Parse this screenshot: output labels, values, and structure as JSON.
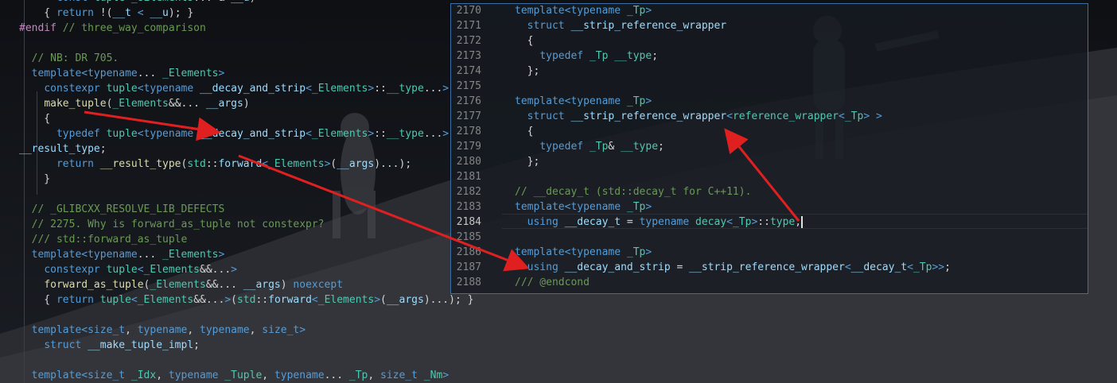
{
  "editor": {
    "main_lines": [
      "      const tuple<_UElements...>& __u)",
      "    { return !(__t < __u); }",
      "#endif // three_way_comparison",
      "",
      "  // NB: DR 705.",
      "  template<typename... _Elements>",
      "    constexpr tuple<typename __decay_and_strip<_Elements>::__type...>",
      "    make_tuple(_Elements&&... __args)",
      "    {",
      "      typedef tuple<typename __decay_and_strip<_Elements>::__type...>",
      "__result_type;",
      "      return __result_type(std::forward<_Elements>(__args)...);",
      "    }",
      "",
      "  // _GLIBCXX_RESOLVE_LIB_DEFECTS",
      "  // 2275. Why is forward_as_tuple not constexpr?",
      "  /// std::forward_as_tuple",
      "  template<typename... _Elements>",
      "    constexpr tuple<_Elements&&...>",
      "    forward_as_tuple(_Elements&&... __args) noexcept",
      "    { return tuple<_Elements&&...>(std::forward<_Elements>(__args)...); }",
      "",
      "  template<size_t, typename, typename, size_t>",
      "    struct __make_tuple_impl;",
      "",
      "  template<size_t _Idx, typename _Tuple, typename... _Tp, size_t _Nm>"
    ],
    "peek_line_numbers": [
      "2170",
      "2171",
      "2172",
      "2173",
      "2174",
      "2175",
      "2176",
      "2177",
      "2178",
      "2179",
      "2180",
      "2181",
      "2182",
      "2183",
      "2184",
      "2185",
      "2186",
      "2187",
      "2188"
    ],
    "peek_active_line": "2184",
    "peek_lines": [
      "template<typename _Tp>",
      "  struct __strip_reference_wrapper",
      "  {",
      "    typedef _Tp __type;",
      "  };",
      "",
      "template<typename _Tp>",
      "  struct __strip_reference_wrapper<reference_wrapper<_Tp> >",
      "  {",
      "    typedef _Tp& __type;",
      "  };",
      "",
      "// __decay_t (std::decay_t for C++11).",
      "template<typename _Tp>",
      "  using __decay_t = typename decay<_Tp>::type;",
      "",
      "template<typename _Tp>",
      "  using __decay_and_strip = __strip_reference_wrapper<__decay_t<_Tp>>;",
      "/// @endcond"
    ]
  },
  "colors": {
    "keyword": "#569cd6",
    "type": "#4ec9b0",
    "function": "#dcdcaa",
    "comment": "#6a9955",
    "preprocessor": "#c586c0",
    "peek_border": "#3a6ea5",
    "annotation_arrow": "#e02020"
  },
  "icons": [
    "annotation-arrow"
  ]
}
